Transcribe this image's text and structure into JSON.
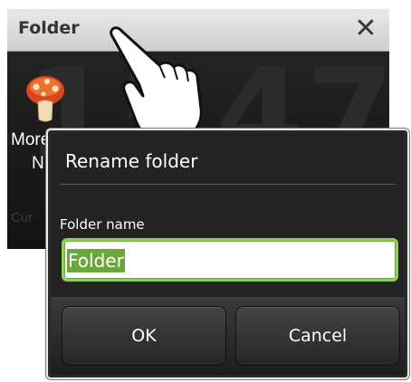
{
  "folder_panel": {
    "title": "Folder",
    "close_glyph": "✕",
    "app": {
      "label_line1": "More",
      "label_line2": "N",
      "icon": "mushroom-icon"
    },
    "footer_text": "Cur",
    "background_digits": [
      "1",
      "5",
      "4",
      "7"
    ]
  },
  "dialog": {
    "title": "Rename folder",
    "field_label": "Folder name",
    "field_value": "Folder",
    "ok_label": "OK",
    "cancel_label": "Cancel"
  },
  "colors": {
    "input_focus": "#8fd05a",
    "selection": "#6aa63a",
    "dialog_bg": "#232323"
  }
}
